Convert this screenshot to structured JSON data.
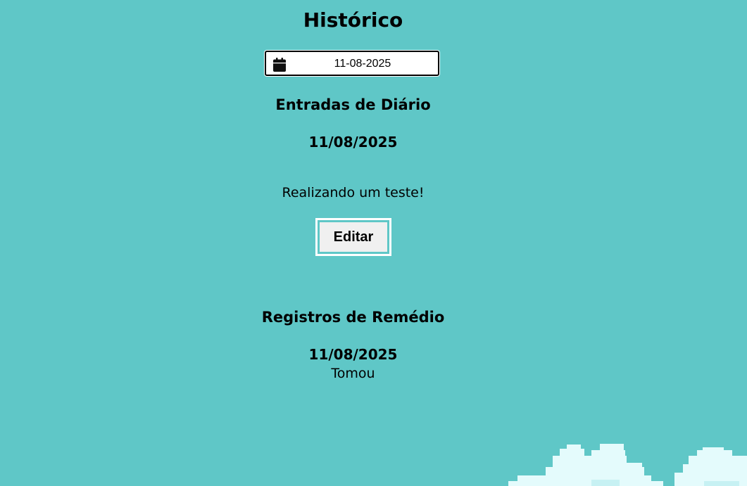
{
  "page": {
    "title": "Histórico"
  },
  "date_filter": {
    "value": "11-08-2025",
    "icon": "calendar-icon"
  },
  "diary": {
    "heading": "Entradas de Diário",
    "entries": [
      {
        "date": "11/08/2025",
        "text": "Realizando um teste!",
        "edit_label": "Editar"
      }
    ]
  },
  "medicine": {
    "heading": "Registros de Remédio",
    "records": [
      {
        "date": "11/08/2025",
        "status": "Tomou"
      }
    ]
  },
  "colors": {
    "background": "#5fc7c7",
    "cloud": "#e4fbfc",
    "cloud_shadow": "#c7f1f3"
  }
}
